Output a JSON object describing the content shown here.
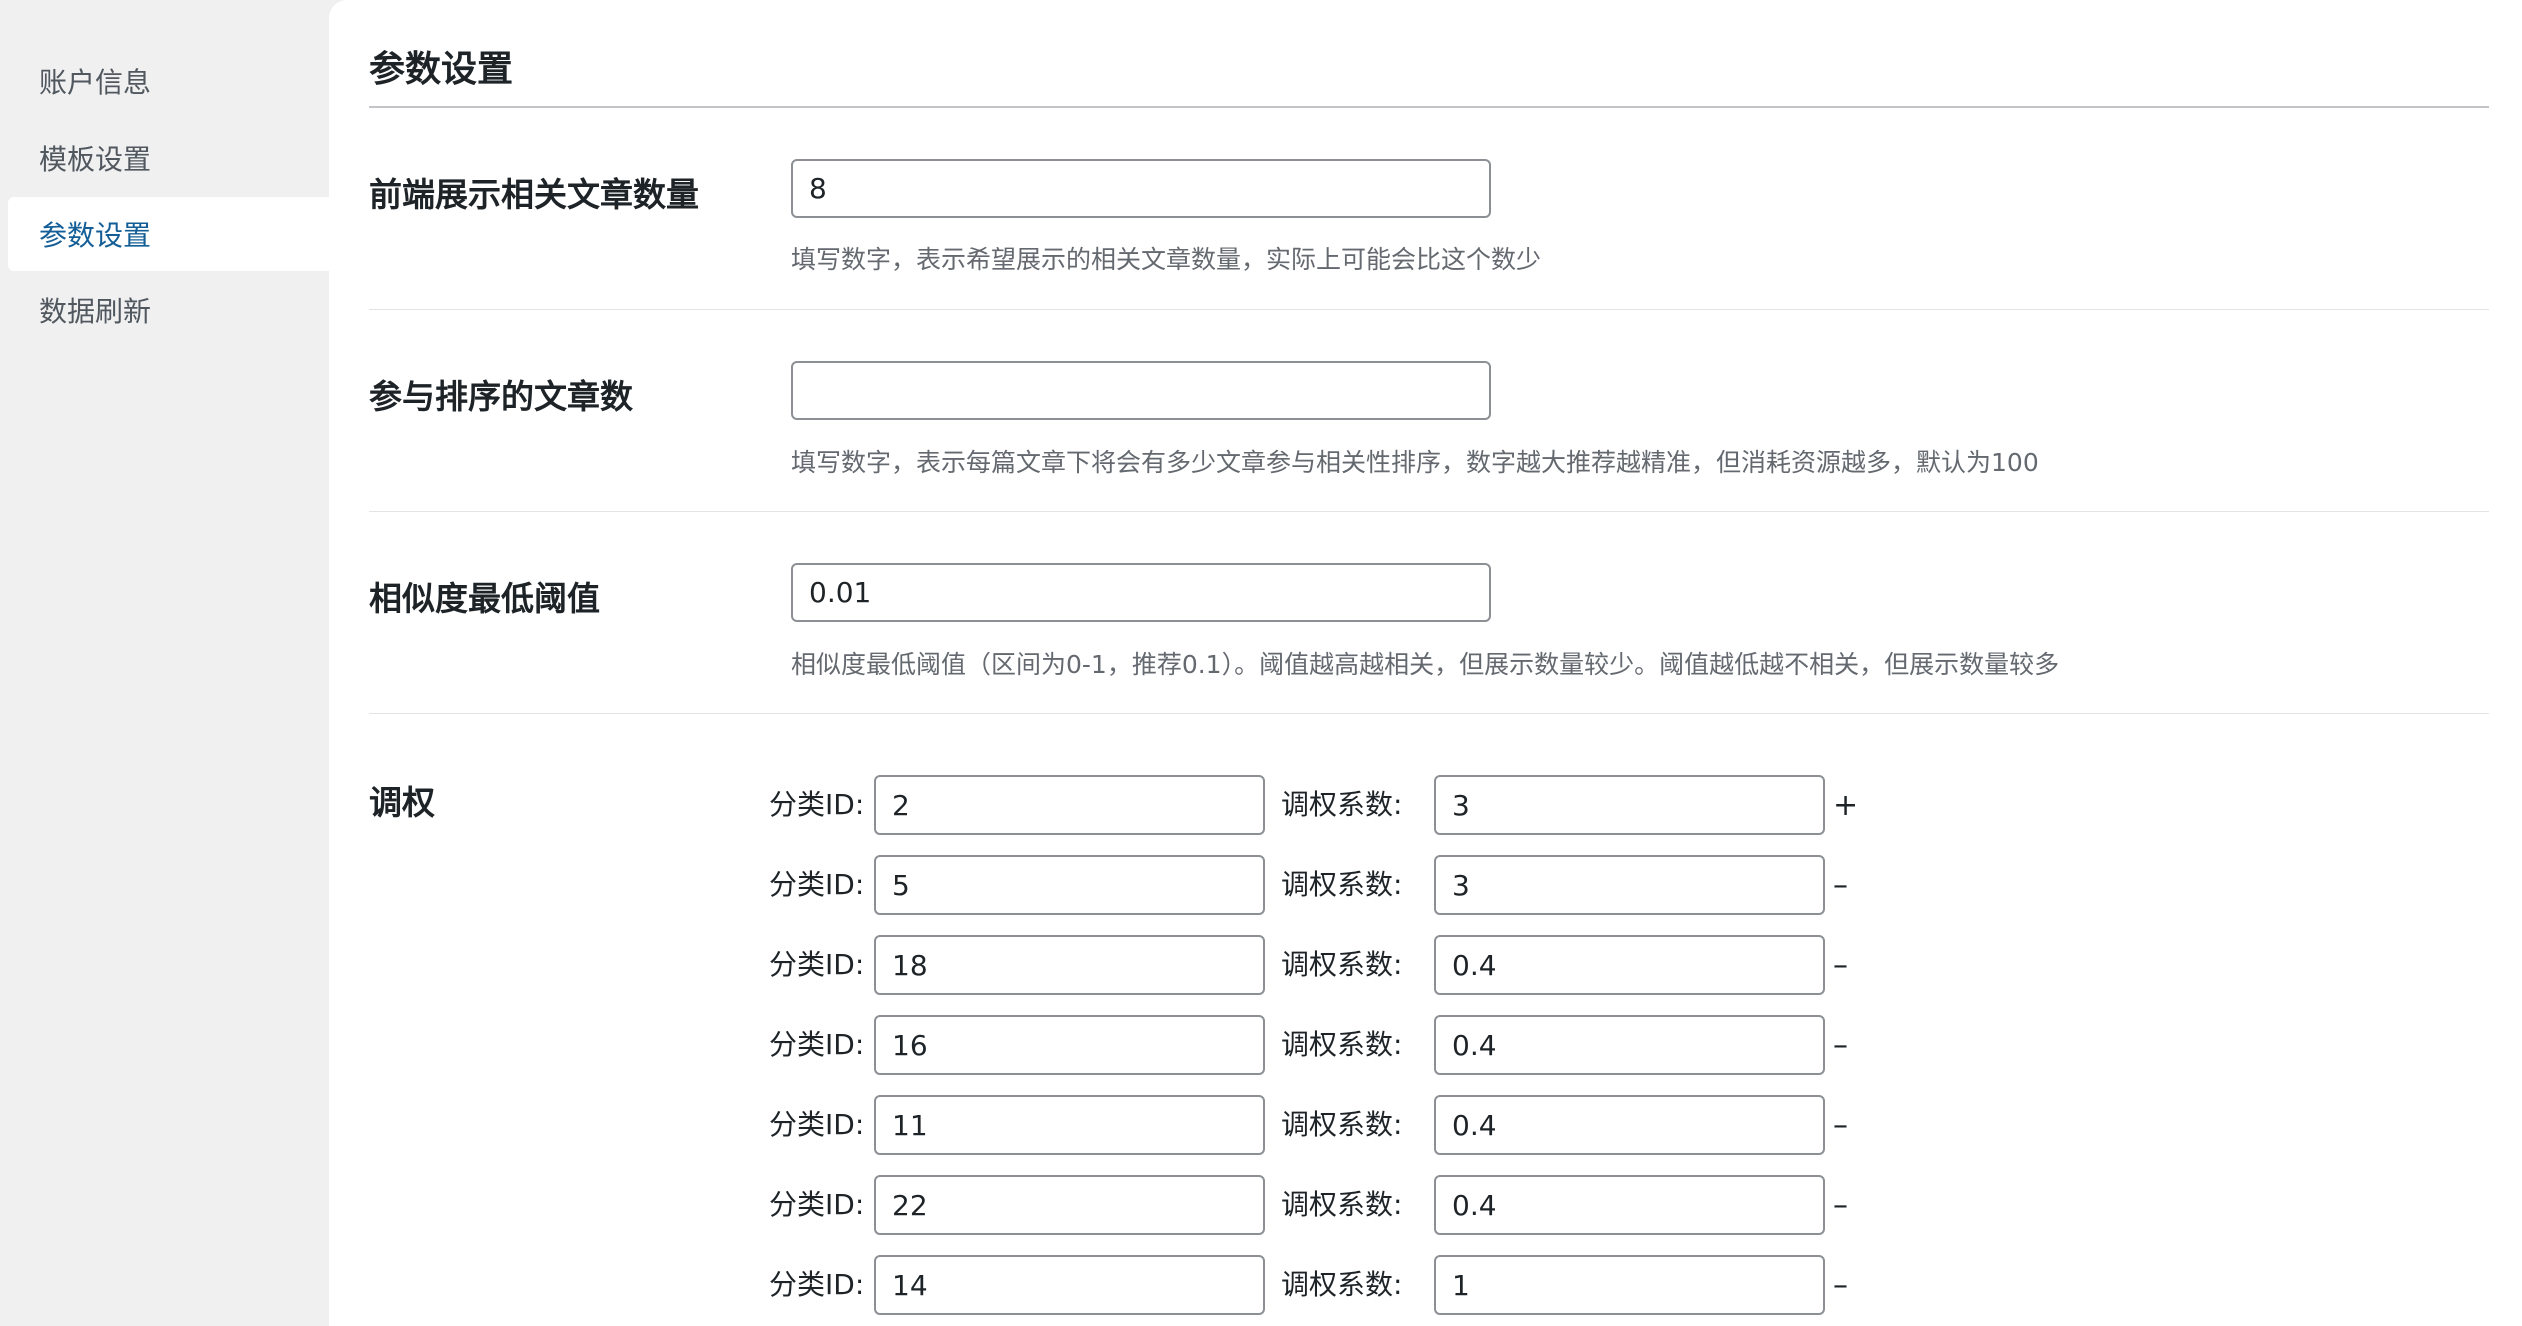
{
  "sidebar": {
    "items": [
      {
        "label": "账户信息",
        "active": false
      },
      {
        "label": "模板设置",
        "active": false
      },
      {
        "label": "参数设置",
        "active": true
      },
      {
        "label": "数据刷新",
        "active": false
      }
    ]
  },
  "main": {
    "title": "参数设置",
    "fields": [
      {
        "label": "前端展示相关文章数量",
        "value": "8",
        "help": "填写数字，表示希望展示的相关文章数量，实际上可能会比这个数少"
      },
      {
        "label": "参与排序的文章数",
        "value": "",
        "help": "填写数字，表示每篇文章下将会有多少文章参与相关性排序，数字越大推荐越精准，但消耗资源越多，默认为100"
      },
      {
        "label": "相似度最低阈值",
        "value": "0.01",
        "help": "相似度最低阈值（区间为0-1，推荐0.1）。阈值越高越相关，但展示数量较少。阈值越低越不相关，但展示数量较多"
      }
    ],
    "weights": {
      "label": "调权",
      "category_label": "分类ID:",
      "factor_label": "调权系数:",
      "add_symbol": "+",
      "remove_symbol": "–",
      "rows": [
        {
          "category_id": "2",
          "factor": "3"
        },
        {
          "category_id": "5",
          "factor": "3"
        },
        {
          "category_id": "18",
          "factor": "0.4"
        },
        {
          "category_id": "16",
          "factor": "0.4"
        },
        {
          "category_id": "11",
          "factor": "0.4"
        },
        {
          "category_id": "22",
          "factor": "0.4"
        },
        {
          "category_id": "14",
          "factor": "1"
        }
      ]
    }
  }
}
